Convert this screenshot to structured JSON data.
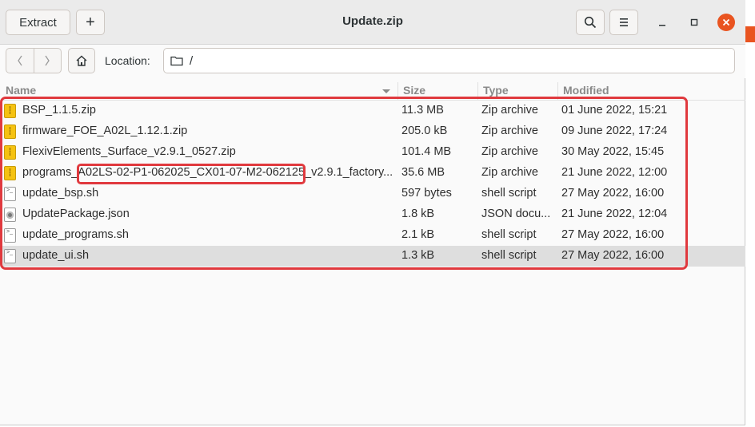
{
  "header": {
    "extract_label": "Extract",
    "new_label": "+",
    "title": "Update.zip",
    "menu_icon": "hamburger-icon",
    "search_icon": "search-icon",
    "minimize_icon": "minimize-icon",
    "maximize_icon": "maximize-icon",
    "close_icon": "close-icon"
  },
  "location": {
    "label": "Location:",
    "path": "/"
  },
  "columns": {
    "name": "Name",
    "size": "Size",
    "type": "Type",
    "modified": "Modified"
  },
  "files": [
    {
      "name": "BSP_1.1.5.zip",
      "size": "11.3 MB",
      "type": "Zip archive",
      "modified": "01 June 2022, 15:21",
      "icon": "zip"
    },
    {
      "name": "firmware_FOE_A02L_1.12.1.zip",
      "size": "205.0 kB",
      "type": "Zip archive",
      "modified": "09 June 2022, 17:24",
      "icon": "zip"
    },
    {
      "name": "FlexivElements_Surface_v2.9.1_0527.zip",
      "size": "101.4 MB",
      "type": "Zip archive",
      "modified": "30 May 2022, 15:45",
      "icon": "zip"
    },
    {
      "name": "programs_A02LS-02-P1-062025_CX01-07-M2-062125_v2.9.1_factory...",
      "size": "35.6 MB",
      "type": "Zip archive",
      "modified": "21 June 2022, 12:00",
      "icon": "zip"
    },
    {
      "name": "update_bsp.sh",
      "size": "597 bytes",
      "type": "shell script",
      "modified": "27 May 2022, 16:00",
      "icon": "sh"
    },
    {
      "name": "UpdatePackage.json",
      "size": "1.8 kB",
      "type": "JSON docu...",
      "modified": "21 June 2022, 12:04",
      "icon": "json"
    },
    {
      "name": "update_programs.sh",
      "size": "2.1 kB",
      "type": "shell script",
      "modified": "27 May 2022, 16:00",
      "icon": "sh"
    },
    {
      "name": "update_ui.sh",
      "size": "1.3 kB",
      "type": "shell script",
      "modified": "27 May 2022, 16:00",
      "icon": "sh",
      "selected": true
    }
  ],
  "colors": {
    "accent": "#e95420",
    "annotation": "#e0393e",
    "zip_icon": "#f5c211"
  }
}
